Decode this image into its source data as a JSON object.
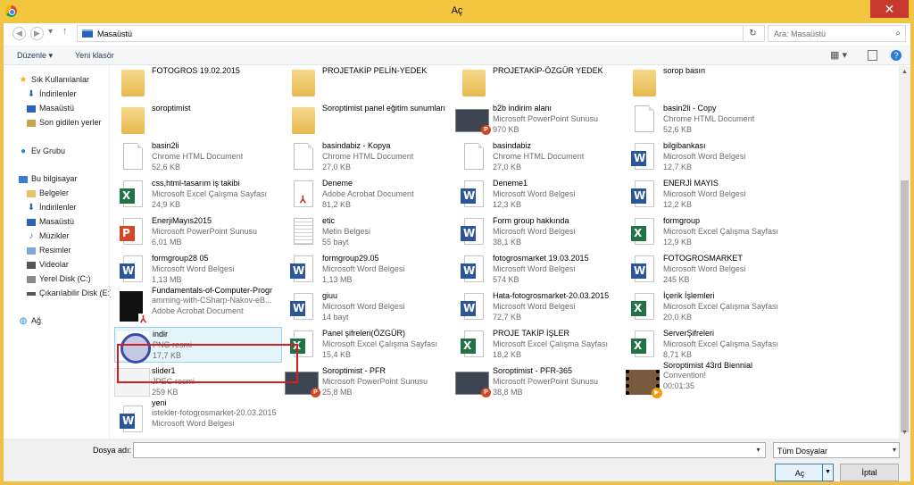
{
  "window": {
    "title": "Aç",
    "close": "✕"
  },
  "nav": {
    "back": "◀",
    "forward": "▶",
    "up": "↑",
    "address": "Masaüstü",
    "refresh": "↻",
    "search_placeholder": "Ara: Masaüstü"
  },
  "toolbar": {
    "organize": "Düzenle ▾",
    "new_folder": "Yeni klasör"
  },
  "sidebar": {
    "favorites": "Sık Kullanılanlar",
    "fav_items": [
      "İndirilenler",
      "Masaüstü",
      "Son gidilen yerler"
    ],
    "homegroup": "Ev Grubu",
    "computer": "Bu bilgisayar",
    "computer_items": [
      "Belgeler",
      "İndirilenler",
      "Masaüstü",
      "Müzikler",
      "Resimler",
      "Videolar",
      "Yerel Disk (C:)",
      "Çıkarılabilir Disk (E:)"
    ],
    "network": "Ağ"
  },
  "files": [
    {
      "name": "FOTOGROS 19.02.2015",
      "type": "",
      "size": "",
      "icon": "folder"
    },
    {
      "name": "PROJETAKİP PELİN-YEDEK",
      "type": "",
      "size": "",
      "icon": "folder-excel"
    },
    {
      "name": "PROJETAKİP-ÖZGÜR YEDEK",
      "type": "",
      "size": "",
      "icon": "folder"
    },
    {
      "name": "sorop basın",
      "type": "",
      "size": "",
      "icon": "folder"
    },
    {
      "name": "soroptimist",
      "type": "",
      "size": "",
      "icon": "folder"
    },
    {
      "name": "Soroptimist panel eğitim sunumları",
      "type": "",
      "size": "",
      "icon": "folder"
    },
    {
      "name": "b2b indirim alanı",
      "type": "Microsoft PowerPoint Sunusu",
      "size": "970 KB",
      "icon": "thumb-ppt"
    },
    {
      "name": "basin2li - Copy",
      "type": "Chrome HTML Document",
      "size": "52,6 KB",
      "icon": "doc"
    },
    {
      "name": "basin2li",
      "type": "Chrome HTML Document",
      "size": "52,6 KB",
      "icon": "doc"
    },
    {
      "name": "basindabiz - Kopya",
      "type": "Chrome HTML Document",
      "size": "27,0 KB",
      "icon": "doc"
    },
    {
      "name": "basindabiz",
      "type": "Chrome HTML Document",
      "size": "27,0 KB",
      "icon": "doc"
    },
    {
      "name": "bilgibankası",
      "type": "Microsoft Word Belgesi",
      "size": "12,7 KB",
      "icon": "word"
    },
    {
      "name": "css,html-tasarım iş takibi",
      "type": "Microsoft Excel Çalışma Sayfası",
      "size": "24,9 KB",
      "icon": "excel"
    },
    {
      "name": "Deneme",
      "type": "Adobe Acrobat Document",
      "size": "81,2 KB",
      "icon": "pdf"
    },
    {
      "name": "Deneme1",
      "type": "Microsoft Word Belgesi",
      "size": "12,3 KB",
      "icon": "word"
    },
    {
      "name": "ENERJİ MAYIS",
      "type": "Microsoft Word Belgesi",
      "size": "12,2 KB",
      "icon": "word"
    },
    {
      "name": "EnerjiMayıs2015",
      "type": "Microsoft PowerPoint Sunusu",
      "size": "6,01 MB",
      "icon": "ppt"
    },
    {
      "name": "etic",
      "type": "Metin Belgesi",
      "size": "55 bayt",
      "icon": "txt"
    },
    {
      "name": "Form group hakkında",
      "type": "Microsoft Word Belgesi",
      "size": "38,1 KB",
      "icon": "word"
    },
    {
      "name": "formgroup",
      "type": "Microsoft Excel Çalışma Sayfası",
      "size": "12,9 KB",
      "icon": "excel"
    },
    {
      "name": "formgroup28 05",
      "type": "Microsoft Word Belgesi",
      "size": "1,13 MB",
      "icon": "word"
    },
    {
      "name": "formgroup29.05",
      "type": "Microsoft Word Belgesi",
      "size": "1,13 MB",
      "icon": "word"
    },
    {
      "name": "fotogrosmarket 19.03.2015",
      "type": "Microsoft Word Belgesi",
      "size": "574 KB",
      "icon": "word"
    },
    {
      "name": "FOTOGROSMARKET",
      "type": "Microsoft Word Belgesi",
      "size": "245 KB",
      "icon": "word"
    },
    {
      "name": "Fundamentals-of-Computer-Progr",
      "name2": "amming-with-CSharp-Nakov-eB...",
      "type": "Adobe Acrobat Document",
      "size": "",
      "icon": "pdfthumb"
    },
    {
      "name": "giuu",
      "type": "Microsoft Word Belgesi",
      "size": "14 bayt",
      "icon": "word"
    },
    {
      "name": "Hata-fotogrosmarket-20.03.2015",
      "type": "Microsoft Word Belgesi",
      "size": "72,7 KB",
      "icon": "word"
    },
    {
      "name": "İçerik İşlemleri",
      "type": "Microsoft Excel Çalışma Sayfası",
      "size": "20,0 KB",
      "icon": "excel"
    },
    {
      "name": "indir",
      "type": "PNG resmi",
      "size": "17,7 KB",
      "icon": "png",
      "selected": true
    },
    {
      "name": "Panel şifreleri(ÖZGÜR)",
      "type": "Microsoft Excel Çalışma Sayfası",
      "size": "15,4 KB",
      "icon": "excel"
    },
    {
      "name": "PROJE TAKİP İŞLER",
      "type": "Microsoft Excel Çalışma Sayfası",
      "size": "18,2 KB",
      "icon": "excel"
    },
    {
      "name": "ServerŞifreleri",
      "type": "Microsoft Excel Çalışma Sayfası",
      "size": "8,71 KB",
      "icon": "excel"
    },
    {
      "name": "slider1",
      "type": "JPEG resmi",
      "size": "259 KB",
      "icon": "img"
    },
    {
      "name": "Soroptimist - PFR",
      "type": "Microsoft PowerPoint Sunusu",
      "size": "25,8 MB",
      "icon": "thumb-ppt"
    },
    {
      "name": "Soroptimist - PFR-365",
      "type": "Microsoft PowerPoint Sunusu",
      "size": "38,8 MB",
      "icon": "thumb-ppt"
    },
    {
      "name": "Soroptimist 43rd Biennial",
      "name2": "Convention!",
      "type": "",
      "size": "00:01:35",
      "icon": "video"
    },
    {
      "name": "yeni",
      "name2": "istekler-fotogrosmarket-20.03.2015",
      "type": "Microsoft Word Belgesi",
      "size": "",
      "icon": "word"
    }
  ],
  "bottom": {
    "filename_label": "Dosya adı:",
    "filename_value": "",
    "filter": "Tüm Dosyalar",
    "open": "Aç",
    "cancel": "İptal"
  }
}
